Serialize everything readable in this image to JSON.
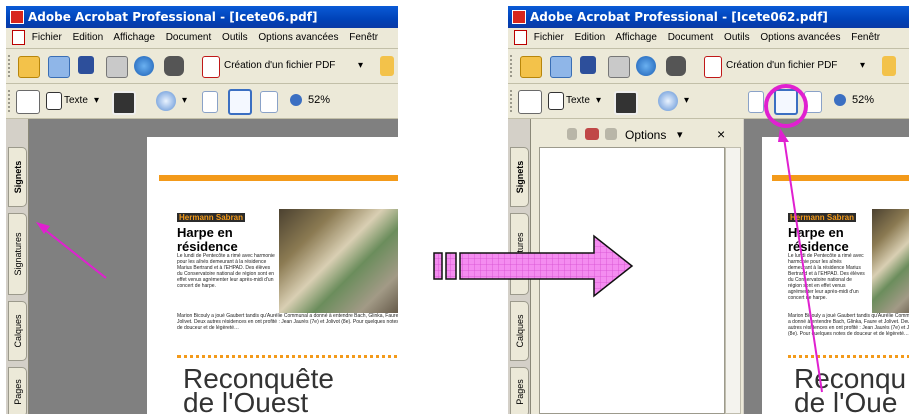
{
  "left": {
    "title": "Adobe Acrobat Professional - [Icete06.pdf]",
    "menu": [
      "Fichier",
      "Edition",
      "Affichage",
      "Document",
      "Outils",
      "Options avancées",
      "Fenêtr"
    ],
    "toolbar1": {
      "create_pdf_label": "Création d'un fichier PDF"
    },
    "toolbar2": {
      "text_tool_label": "Texte",
      "zoom_value": "52%"
    },
    "nav_tabs": [
      "Signets",
      "Signatures",
      "Calques",
      "Pages"
    ],
    "article": {
      "author": "Hermann Sabran",
      "headline_line1": "Harpe en",
      "headline_line2": "résidence",
      "body": "Le lundi de Pentecôte a rimé avec harmonie pour les aînés demeurant à la résidence Marius Bertrand et à l'EHPAD. Des élèves du Conservatoire national de région sont en effet venus agrémenter leur après-midi d'un concert de harpe.",
      "body2": "Marion Bicouly a joué Gaubert tandis qu'Aurélie Communal a donné à entendre Bach, Glinka, Faure et Jolivet. Deux autres résidences en ont profité : Jean Jaurès (7e) et Jolivot (8e). Pour quelques notes de douceur et de légèreté…",
      "big_title_line1": "Reconquête",
      "big_title_line2": "de l'Ouest"
    }
  },
  "right": {
    "title": "Adobe Acrobat Professional - [Icete062.pdf]",
    "menu": [
      "Fichier",
      "Edition",
      "Affichage",
      "Document",
      "Outils",
      "Options avancées",
      "Fenêtr"
    ],
    "toolbar1": {
      "create_pdf_label": "Création d'un fichier PDF"
    },
    "toolbar2": {
      "text_tool_label": "Texte",
      "zoom_value": "52%"
    },
    "nav_tabs": [
      "Signets",
      "Signatures",
      "Calques",
      "Pages"
    ],
    "options_panel": {
      "options_label": "Options",
      "close_label": "×"
    },
    "article": {
      "author": "Hermann Sabran",
      "headline_line1": "Harpe en",
      "headline_line2": "résidence",
      "body": "Le lundi de Pentecôte a rimé avec harmonie pour les aînés demeurant à la résidence Marius Bertrand et à l'EHPAD. Des élèves du Conservatoire national de région sont en effet venus agrémenter leur après-midi d'un concert de harpe.",
      "body2": "Marion Bicouly a joué Gaubert tandis qu'Aurélie Communal a donné à entendre Bach, Glinka, Faure et Jolivet. Deux autres résidences en ont profité : Jean Jaurès (7e) et Jolivot (8e). Pour quelques notes de douceur et de légèreté…",
      "big_title_line1": "Reconqu",
      "big_title_line2": "de l'Oue"
    }
  },
  "colors": {
    "annotation": "#e020d0",
    "accent_orange": "#f39a1a",
    "titlebar_blue": "#0042b8"
  }
}
